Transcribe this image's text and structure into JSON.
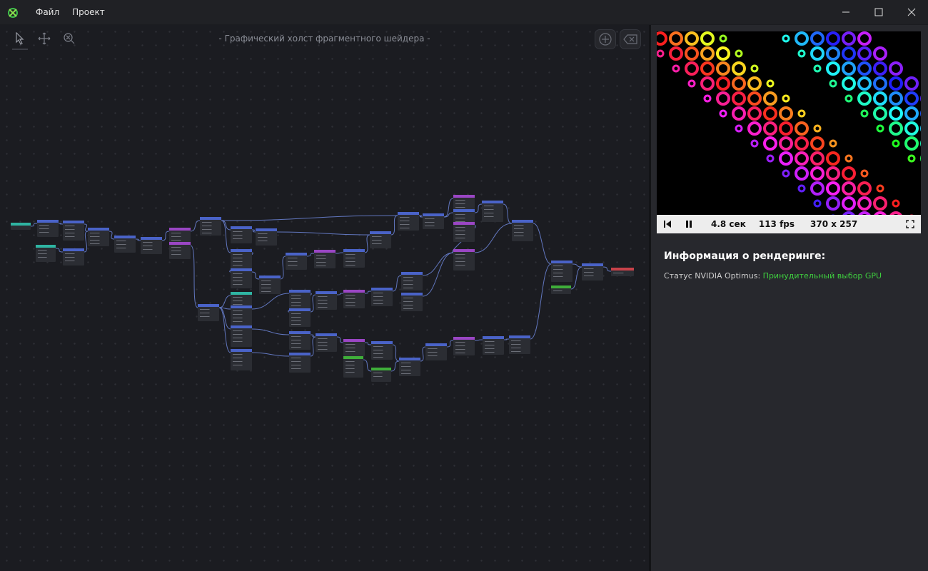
{
  "menu": {
    "file": "Файл",
    "project": "Проект"
  },
  "canvas": {
    "title": "- Графический холст фрагментного шейдера -"
  },
  "player": {
    "time": "4.8 сек",
    "fps": "113 fps",
    "resolution": "370 x 257"
  },
  "render_info": {
    "title": "Информация о рендеринге:",
    "optimus_label": "Статус NVIDIA Optimus:",
    "optimus_value": "Принудительный выбор GPU"
  },
  "colors": {
    "accent_green": "#3fcf3f",
    "node_blue": "#4a63c8",
    "node_purple": "#9a46c4",
    "node_teal": "#2fb5a3",
    "node_green": "#3fae3a",
    "node_red": "#c8424a",
    "wire": "#6d86d9"
  },
  "icons": {
    "select_tool": "pointer-icon",
    "pan_tool": "move-icon",
    "zoom_tool": "zoom-icon",
    "add_node": "plus-circle-icon",
    "delete_node": "backspace-icon",
    "restart": "skip-back-icon",
    "pause": "pause-icon",
    "fullscreen": "fullscreen-icon"
  }
}
